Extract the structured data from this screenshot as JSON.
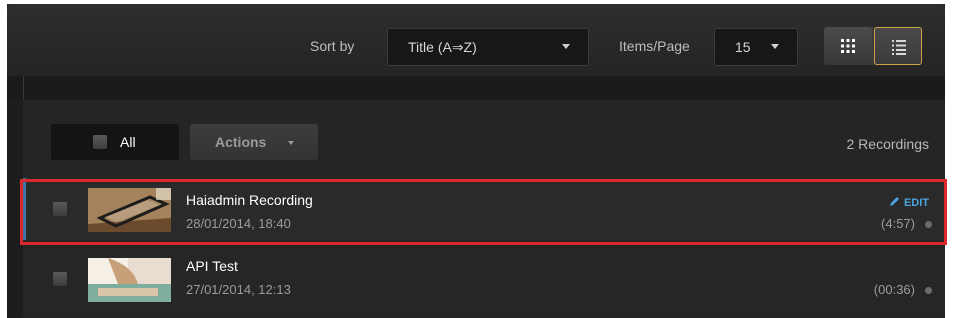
{
  "toolbar": {
    "sort_label": "Sort by",
    "sort_value": "Title (A⇒Z)",
    "items_label": "Items/Page",
    "items_value": "15",
    "view_modes": [
      "grid-view-icon",
      "list-view-icon"
    ],
    "active_view": "list"
  },
  "list_controls": {
    "all_label": "All",
    "actions_label": "Actions",
    "count_text": "2 Recordings"
  },
  "recordings": [
    {
      "title": "Haiadmin Recording",
      "date": "28/01/2014, 18:40",
      "duration": "(4:57)",
      "edit_label": "EDIT",
      "selected": true
    },
    {
      "title": "API Test",
      "date": "27/01/2014, 12:13",
      "duration": "(00:36)",
      "selected": false
    }
  ],
  "colors": {
    "accent": "#4aa3df",
    "highlight_border": "#d9282e",
    "active_view_border": "#c9a24a"
  }
}
